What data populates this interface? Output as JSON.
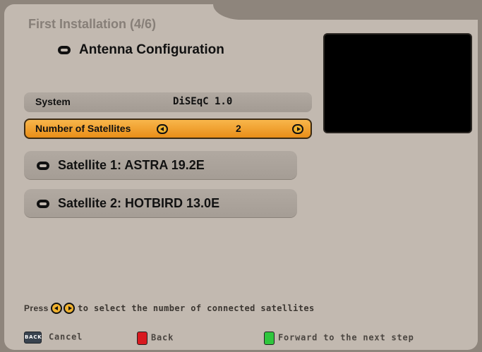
{
  "header": {
    "title": "First Installation (4/6)",
    "subtitle": "Antenna Configuration"
  },
  "settings": {
    "system": {
      "label": "System",
      "value": "DiSEqC 1.0"
    },
    "satellites_count": {
      "label": "Number of Satellites",
      "value": "2"
    }
  },
  "satellites": [
    {
      "label": "Satellite 1: ASTRA 19.2E"
    },
    {
      "label": "Satellite 2: HOTBIRD 13.0E"
    }
  ],
  "help": {
    "prefix": "Press",
    "suffix": "to select the number of connected satellites"
  },
  "footer": {
    "back_key_text": "BACK",
    "cancel_label": "Cancel",
    "back_label": "Back",
    "forward_label": "Forward to the next step"
  },
  "colors": {
    "highlight": "#f0a02a",
    "red_key": "#d8191f",
    "green_key": "#2fc63d"
  }
}
